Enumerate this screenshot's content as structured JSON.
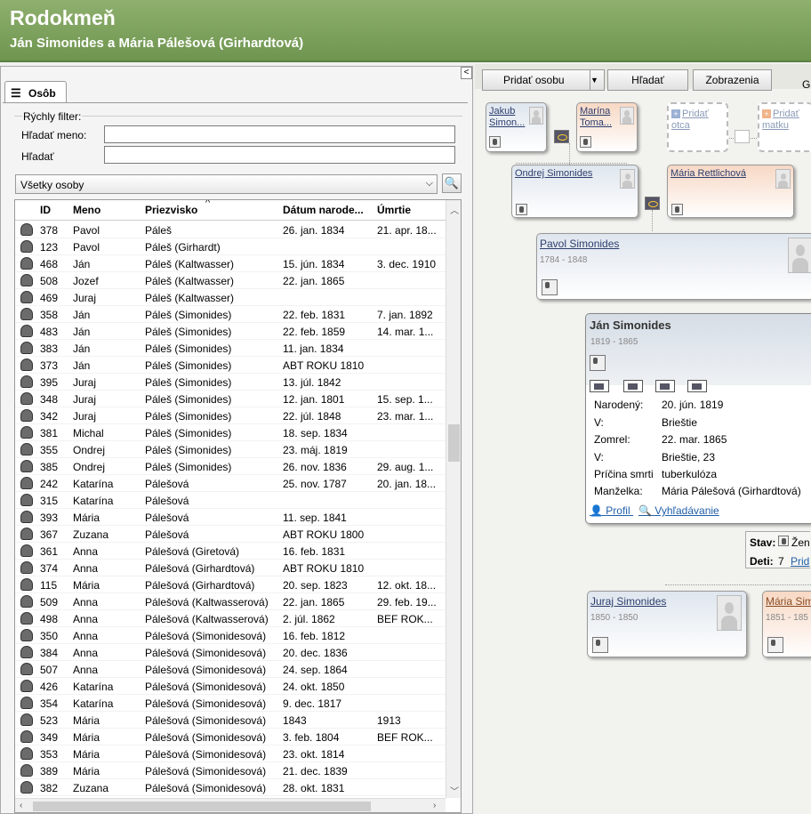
{
  "header": {
    "title": "Rodokmeň",
    "subtitle": "Ján Simonides a Mária Pálešová (Girhardtová)"
  },
  "left": {
    "collapse_label": "<",
    "tab_label": "Osôb",
    "filter": {
      "legend": "Rýchly filter:",
      "name_label": "Hľadať meno:",
      "name_value": "",
      "search_label": "Hľadať",
      "search_value": ""
    },
    "select_value": "Všetky osoby",
    "columns": [
      "ID",
      "Meno",
      "Priezvisko",
      "Dátum narode...",
      "Úmrtie"
    ],
    "rows": [
      [
        "378",
        "Pavol",
        "Páleš",
        "26. jan. 1834",
        "21. apr. 18..."
      ],
      [
        "123",
        "Pavol",
        "Páleš (Girhardt)",
        "",
        ""
      ],
      [
        "468",
        "Ján",
        "Páleš (Kaltwasser)",
        "15. jún. 1834",
        "3. dec. 1910"
      ],
      [
        "508",
        "Jozef",
        "Páleš (Kaltwasser)",
        "22. jan. 1865",
        ""
      ],
      [
        "469",
        "Juraj",
        "Páleš (Kaltwasser)",
        "",
        ""
      ],
      [
        "358",
        "Ján",
        "Páleš (Simonides)",
        "22. feb. 1831",
        "7. jan. 1892"
      ],
      [
        "483",
        "Ján",
        "Páleš (Simonides)",
        "22. feb. 1859",
        "14. mar. 1..."
      ],
      [
        "383",
        "Ján",
        "Páleš (Simonides)",
        "11. jan. 1834",
        ""
      ],
      [
        "373",
        "Ján",
        "Páleš (Simonides)",
        "ABT ROKU 1810",
        ""
      ],
      [
        "395",
        "Juraj",
        "Páleš (Simonides)",
        "13. júl. 1842",
        ""
      ],
      [
        "348",
        "Juraj",
        "Páleš (Simonides)",
        "12. jan. 1801",
        "15. sep. 1..."
      ],
      [
        "342",
        "Juraj",
        "Páleš (Simonides)",
        "22. júl. 1848",
        "23. mar. 1..."
      ],
      [
        "381",
        "Michal",
        "Páleš (Simonides)",
        "18. sep. 1834",
        ""
      ],
      [
        "355",
        "Ondrej",
        "Páleš (Simonides)",
        "23. máj. 1819",
        ""
      ],
      [
        "385",
        "Ondrej",
        "Páleš (Simonides)",
        "26. nov. 1836",
        "29. aug. 1..."
      ],
      [
        "242",
        "Katarína",
        "Pálešová",
        "25. nov. 1787",
        "20. jan. 18..."
      ],
      [
        "315",
        "Katarína",
        "Pálešová",
        "",
        ""
      ],
      [
        "393",
        "Mária",
        "Pálešová",
        "11. sep. 1841",
        ""
      ],
      [
        "367",
        "Zuzana",
        "Pálešová",
        "ABT ROKU 1800",
        ""
      ],
      [
        "361",
        "Anna",
        "Pálešová (Giretová)",
        "16. feb. 1831",
        ""
      ],
      [
        "374",
        "Anna",
        "Pálešová (Girhardtová)",
        "ABT ROKU 1810",
        ""
      ],
      [
        "115",
        "Mária",
        "Pálešová (Girhardtová)",
        "20. sep. 1823",
        "12. okt. 18..."
      ],
      [
        "509",
        "Anna",
        "Pálešová (Kaltwasserová)",
        "22. jan. 1865",
        "29. feb. 19..."
      ],
      [
        "498",
        "Anna",
        "Pálešová (Kaltwasserová)",
        "2. júl. 1862",
        "BEF ROK..."
      ],
      [
        "350",
        "Anna",
        "Pálešová (Simonidesová)",
        "16. feb. 1812",
        ""
      ],
      [
        "384",
        "Anna",
        "Pálešová (Simonidesová)",
        "20. dec. 1836",
        ""
      ],
      [
        "507",
        "Anna",
        "Pálešová (Simonidesová)",
        "24. sep. 1864",
        ""
      ],
      [
        "426",
        "Katarína",
        "Pálešová (Simonidesová)",
        "24. okt. 1850",
        ""
      ],
      [
        "354",
        "Katarína",
        "Pálešová (Simonidesová)",
        "9. dec. 1817",
        ""
      ],
      [
        "523",
        "Mária",
        "Pálešová (Simonidesová)",
        "1843",
        "1913"
      ],
      [
        "349",
        "Mária",
        "Pálešová (Simonidesová)",
        "3. feb. 1804",
        "BEF ROK..."
      ],
      [
        "353",
        "Mária",
        "Pálešová (Simonidesová)",
        "23. okt. 1814",
        ""
      ],
      [
        "389",
        "Mária",
        "Pálešová (Simonidesová)",
        "21. dec. 1839",
        ""
      ],
      [
        "382",
        "Zuzana",
        "Pálešová (Simonidesová)",
        "28. okt. 1831",
        ""
      ]
    ]
  },
  "toolbar": {
    "add_person": "Pridať osobu",
    "search": "Hľadať",
    "views": "Zobrazenia",
    "cut": "G"
  },
  "tree": {
    "jakub": "Jakub Simon...",
    "marina": "Marína Toma...",
    "add_father": "Pridať otca",
    "add_mother": "Pridať matku",
    "ondrej": "Ondrej Simonides",
    "maria_r": "Mária Rettlichová",
    "pavol": {
      "name": "Pavol Simonides",
      "years": "1784 - 1848"
    },
    "jan": {
      "name": "Ján Simonides",
      "years": "1819 - 1865",
      "details": [
        [
          "Narodený:",
          "20. jún. 1819"
        ],
        [
          "V:",
          "Brieštie"
        ],
        [
          "Zomrel:",
          "22. mar. 1865"
        ],
        [
          "V:",
          "Brieštie, 23"
        ],
        [
          "Príčina smrti",
          "tuberkulóza"
        ],
        [
          "Manželka:",
          "Mária Pálešová (Girhardtová)"
        ]
      ],
      "profile": "Profil",
      "search": "Vyhľadávanie"
    },
    "stav_label": "Stav:",
    "stav_value": "Žen",
    "deti_label": "Deti:",
    "deti_value": "7",
    "deti_link": "Prid",
    "juraj": {
      "name": "Juraj Simonides",
      "years": "1850 - 1850"
    },
    "maria_s": {
      "name": "Mária Sim",
      "years": "1851 - 185"
    }
  }
}
